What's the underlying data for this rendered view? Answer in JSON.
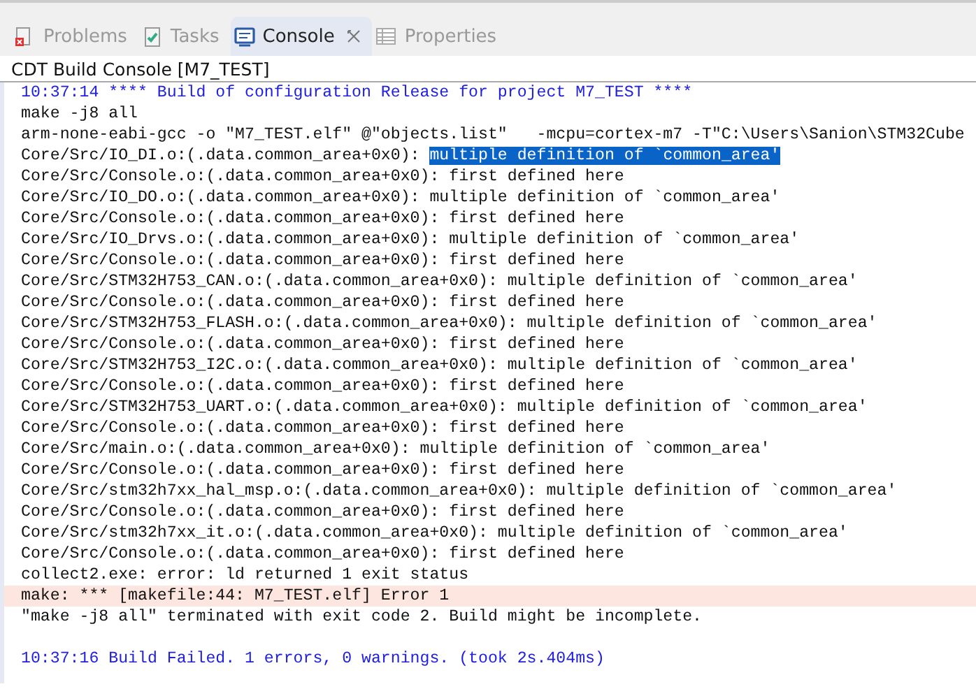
{
  "tabs": [
    {
      "label": "Problems",
      "kind": "problems",
      "selected": false,
      "closable": false
    },
    {
      "label": "Tasks",
      "kind": "tasks",
      "selected": false,
      "closable": false
    },
    {
      "label": "Console",
      "kind": "console",
      "selected": true,
      "closable": true
    },
    {
      "label": "Properties",
      "kind": "properties",
      "selected": false,
      "closable": false
    }
  ],
  "console": {
    "title": "CDT Build Console [M7_TEST]",
    "lines": [
      {
        "kind": "info",
        "text": "10:37:14 **** Build of configuration Release for project M7_TEST ****"
      },
      {
        "kind": "normal",
        "text": "make -j8 all"
      },
      {
        "kind": "normal",
        "text": "arm-none-eabi-gcc -o \"M7_TEST.elf\" @\"objects.list\"   -mcpu=cortex-m7 -T\"C:\\Users\\Sanion\\STM32Cube"
      },
      {
        "kind": "normal",
        "text": "Core/Src/IO_DI.o:(.data.common_area+0x0): ",
        "selection": "multiple definition of `common_area'"
      },
      {
        "kind": "normal",
        "text": "Core/Src/Console.o:(.data.common_area+0x0): first defined here"
      },
      {
        "kind": "normal",
        "text": "Core/Src/IO_DO.o:(.data.common_area+0x0): multiple definition of `common_area'"
      },
      {
        "kind": "normal",
        "text": "Core/Src/Console.o:(.data.common_area+0x0): first defined here"
      },
      {
        "kind": "normal",
        "text": "Core/Src/IO_Drvs.o:(.data.common_area+0x0): multiple definition of `common_area'"
      },
      {
        "kind": "normal",
        "text": "Core/Src/Console.o:(.data.common_area+0x0): first defined here"
      },
      {
        "kind": "normal",
        "text": "Core/Src/STM32H753_CAN.o:(.data.common_area+0x0): multiple definition of `common_area'"
      },
      {
        "kind": "normal",
        "text": "Core/Src/Console.o:(.data.common_area+0x0): first defined here"
      },
      {
        "kind": "normal",
        "text": "Core/Src/STM32H753_FLASH.o:(.data.common_area+0x0): multiple definition of `common_area'"
      },
      {
        "kind": "normal",
        "text": "Core/Src/Console.o:(.data.common_area+0x0): first defined here"
      },
      {
        "kind": "normal",
        "text": "Core/Src/STM32H753_I2C.o:(.data.common_area+0x0): multiple definition of `common_area'"
      },
      {
        "kind": "normal",
        "text": "Core/Src/Console.o:(.data.common_area+0x0): first defined here"
      },
      {
        "kind": "normal",
        "text": "Core/Src/STM32H753_UART.o:(.data.common_area+0x0): multiple definition of `common_area'"
      },
      {
        "kind": "normal",
        "text": "Core/Src/Console.o:(.data.common_area+0x0): first defined here"
      },
      {
        "kind": "normal",
        "text": "Core/Src/main.o:(.data.common_area+0x0): multiple definition of `common_area'"
      },
      {
        "kind": "normal",
        "text": "Core/Src/Console.o:(.data.common_area+0x0): first defined here"
      },
      {
        "kind": "normal",
        "text": "Core/Src/stm32h7xx_hal_msp.o:(.data.common_area+0x0): multiple definition of `common_area'"
      },
      {
        "kind": "normal",
        "text": "Core/Src/Console.o:(.data.common_area+0x0): first defined here"
      },
      {
        "kind": "normal",
        "text": "Core/Src/stm32h7xx_it.o:(.data.common_area+0x0): multiple definition of `common_area'"
      },
      {
        "kind": "normal",
        "text": "Core/Src/Console.o:(.data.common_area+0x0): first defined here"
      },
      {
        "kind": "normal",
        "text": "collect2.exe: error: ld returned 1 exit status"
      },
      {
        "kind": "error",
        "text": "make: *** [makefile:44: M7_TEST.elf] Error 1"
      },
      {
        "kind": "normal",
        "text": "\"make -j8 all\" terminated with exit code 2. Build might be incomplete."
      },
      {
        "kind": "blank"
      },
      {
        "kind": "info",
        "text": "10:37:16 Build Failed. 1 errors, 0 warnings. (took 2s.404ms)"
      }
    ]
  }
}
